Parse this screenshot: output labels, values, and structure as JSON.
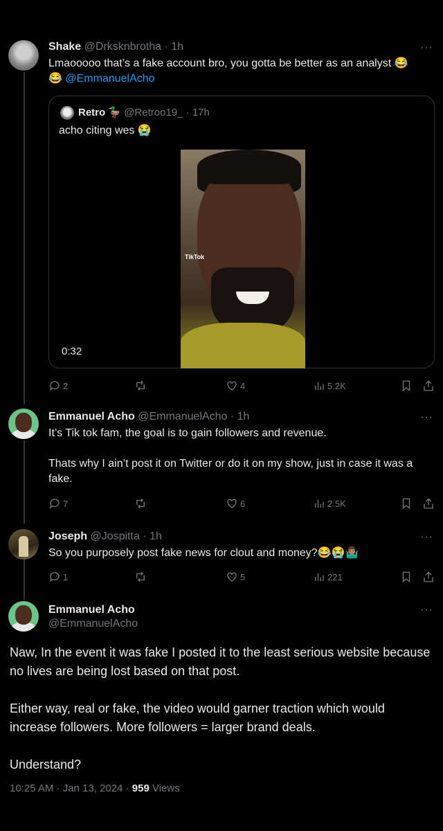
{
  "tweets": [
    {
      "name": "Shake",
      "handle": "@Drksknbrotha",
      "time": "· 1h",
      "text": "Lmaooooo that’s a fake account bro, you gotta be better as an analyst 😂",
      "text_line2_emoji": "😂",
      "mention": "@EmmanuelAcho",
      "actions": {
        "replies": "2",
        "retweets": "",
        "likes": "4",
        "views": "5.2K"
      }
    },
    {
      "name": "Emmanuel Acho",
      "handle": "@EmmanuelAcho",
      "time": "· 1h",
      "para1": "It’s Tik tok fam, the goal is to gain followers and revenue.",
      "para2": "Thats why I ain’t post it on Twitter or do it on my show, just in case it was a fake.",
      "actions": {
        "replies": "7",
        "retweets": "",
        "likes": "6",
        "views": "2.5K"
      }
    },
    {
      "name": "Joseph",
      "handle": "@Jospitta",
      "time": "· 1h",
      "text": "So you purposely post fake news for clout and money?😂😭🤷🏽‍♂️",
      "actions": {
        "replies": "1",
        "retweets": "",
        "likes": "5",
        "views": "221"
      }
    }
  ],
  "quote": {
    "name": "Retro",
    "badge": "🦆",
    "handle": "@Retroo19_",
    "time": "· 17h",
    "text": "acho citing wes 😭",
    "video_duration": "0:32",
    "video_watermark": "TikTok"
  },
  "main": {
    "name": "Emmanuel Acho",
    "handle": "@EmmanuelAcho",
    "para1": "Naw, In the event it was fake I posted it to the least serious website because no lives are being lost based on that post.",
    "para2": "Either way, real or fake, the video would garner traction which would increase followers. More followers = larger brand deals.",
    "para3": "Understand?",
    "timestamp": "10:25 AM · Jan 13, 2024 · ",
    "views_count": "959",
    "views_label": " Views"
  },
  "more_label": "···",
  "colors": {
    "background": "#000000",
    "text": "#e7e9ea",
    "muted": "#71767b",
    "link": "#1d9bf0",
    "border": "#2f3336"
  }
}
